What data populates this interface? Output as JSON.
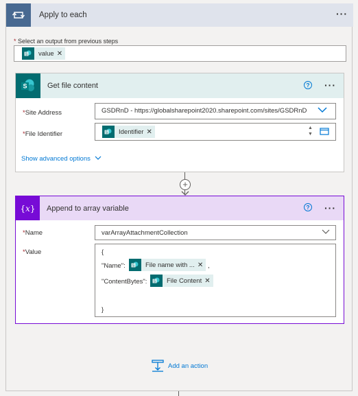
{
  "loop": {
    "title": "Apply to each",
    "select_label": "Select an output from previous steps",
    "select_token": "value"
  },
  "get_file": {
    "title": "Get file content",
    "site_label": "Site Address",
    "site_value": "GSDRnD - https://globalsharepoint2020.sharepoint.com/sites/GSDRnD",
    "file_label": "File Identifier",
    "file_token": "Identifier",
    "advanced": "Show advanced options"
  },
  "append": {
    "title": "Append to array variable",
    "name_label": "Name",
    "name_value": "varArrayAttachmentCollection",
    "value_label": "Value",
    "line1": "{",
    "name_key": "\"Name\":",
    "name_token": "File name with ...",
    "comma": ",",
    "content_key": "\"ContentBytes\":",
    "content_token": "File Content",
    "line_end": "}"
  },
  "add_action": "Add an action",
  "colors": {
    "loop_header": "#dfe3ec",
    "loop_icon": "#486991",
    "sharepoint": "#036c70",
    "variable": "#770bd6",
    "variable_header": "#e9d9f6",
    "sharepoint_header": "#e1efef",
    "link": "#0078d4"
  },
  "icons": [
    "loop-icon",
    "sharepoint-icon",
    "variable-icon",
    "help-icon",
    "more-icon",
    "chevron-down-icon",
    "swap-icon",
    "folder-icon",
    "add-action-icon"
  ]
}
